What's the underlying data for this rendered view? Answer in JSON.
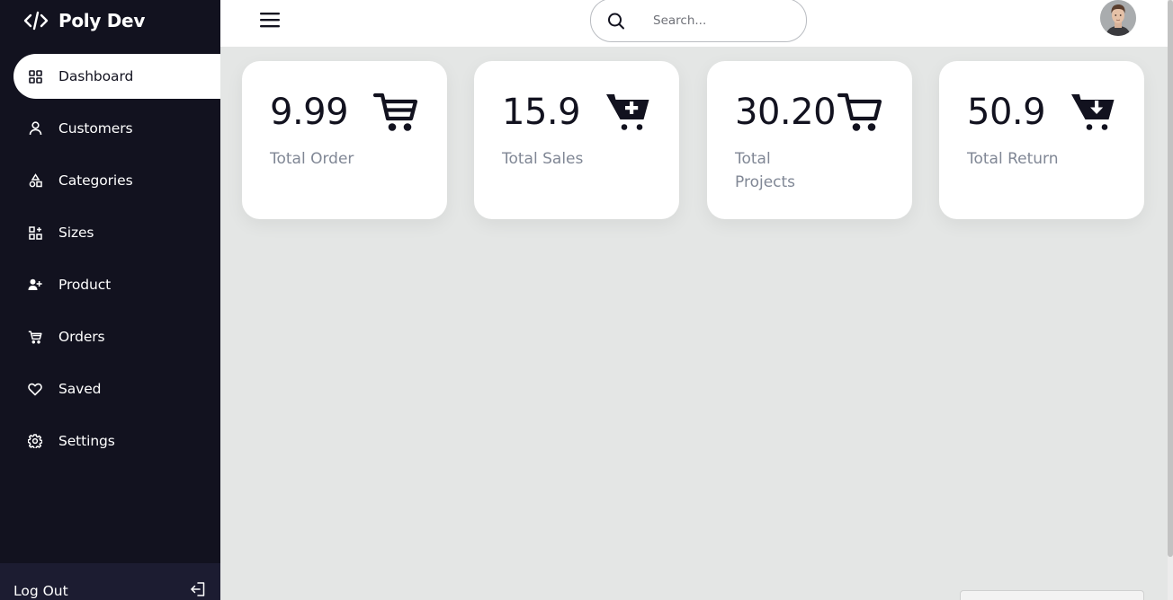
{
  "brand": {
    "name": "Poly Dev",
    "icon": "code-icon"
  },
  "sidebar": {
    "items": [
      {
        "label": "Dashboard",
        "icon": "grid-icon",
        "active": true
      },
      {
        "label": "Customers",
        "icon": "user-icon"
      },
      {
        "label": "Categories",
        "icon": "shapes-icon"
      },
      {
        "label": "Sizes",
        "icon": "apps-icon"
      },
      {
        "label": "Product",
        "icon": "user-plus-icon"
      },
      {
        "label": "Orders",
        "icon": "cart-icon"
      },
      {
        "label": "Saved",
        "icon": "heart-icon"
      },
      {
        "label": "Settings",
        "icon": "gear-icon"
      }
    ],
    "logout": {
      "label": "Log Out",
      "icon": "logout-icon"
    }
  },
  "topbar": {
    "menu_icon": "hamburger-menu-icon",
    "search": {
      "placeholder": "Search...",
      "icon": "search-icon"
    },
    "avatar": "user-avatar"
  },
  "cards": [
    {
      "value": "9.99",
      "label": "Total Order",
      "icon": "cart-icon"
    },
    {
      "value": "15.9",
      "label": "Total Sales",
      "icon": "cart-plus-icon"
    },
    {
      "value": "30.20",
      "label": "Total Projects",
      "icon": "cart-outline-icon"
    },
    {
      "value": "50.9",
      "label": "Total Return",
      "icon": "cart-arrow-down-icon"
    }
  ],
  "colors": {
    "sidebar_bg": "#12121f",
    "content_bg": "#e4e6e5",
    "card_bg": "#ffffff",
    "muted_text": "#808795"
  }
}
